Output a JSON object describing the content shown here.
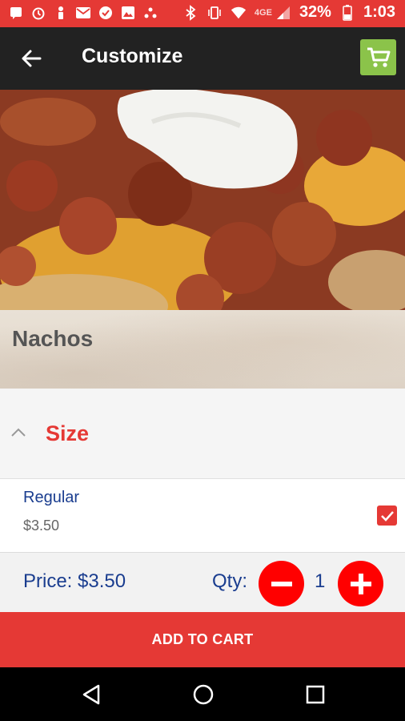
{
  "status_bar": {
    "battery_percent": "32%",
    "time": "1:03",
    "network": "4GE",
    "left_icons": [
      "chat-icon",
      "alarm-icon",
      "figure-icon",
      "email-icon",
      "check-icon",
      "image-icon",
      "dots-icon"
    ],
    "right_icons": [
      "bluetooth-icon",
      "vibrate-icon",
      "wifi-icon",
      "signal-icon",
      "battery-icon"
    ]
  },
  "app_bar": {
    "title": "Customize",
    "back_icon": "arrow-left-icon",
    "cart_icon": "shopping-cart-icon",
    "cart_color": "#8bc34a"
  },
  "item": {
    "name": "Nachos"
  },
  "section": {
    "title": "Size",
    "expanded": true,
    "toggle_icon": "chevron-up-icon"
  },
  "options": [
    {
      "name": "Regular",
      "price": "$3.50",
      "checked": true
    }
  ],
  "order": {
    "price_text": "Price: $3.50",
    "qty_label": "Qty:",
    "qty_value": "1"
  },
  "actions": {
    "add_to_cart": "ADD TO CART"
  },
  "colors": {
    "accent": "#e53935",
    "text_blue": "#1a3d8f",
    "app_bar": "#222222"
  }
}
